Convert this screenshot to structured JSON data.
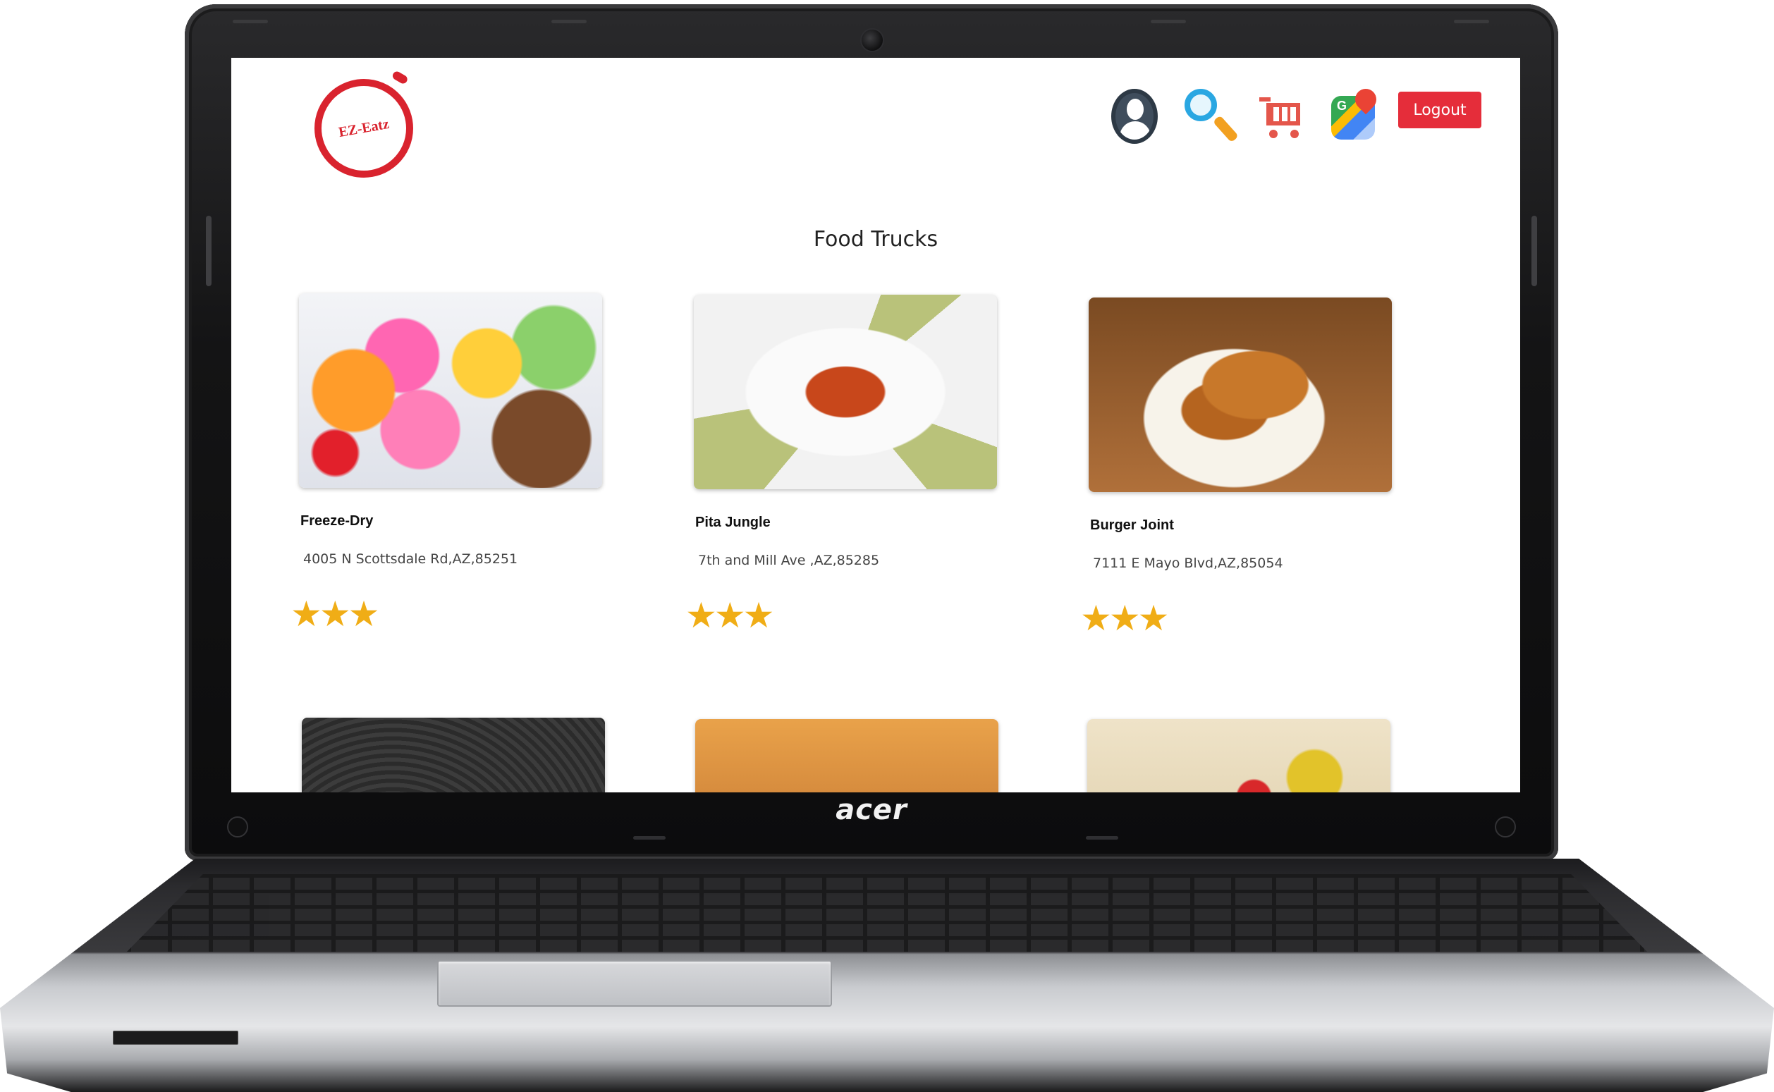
{
  "device": {
    "brand": "acer"
  },
  "app": {
    "logo_text": "EZ-Eatz",
    "logout_label": "Logout",
    "nav_icons": [
      "user-icon",
      "search-icon",
      "cart-icon",
      "maps-icon"
    ]
  },
  "page": {
    "title": "Food Trucks"
  },
  "trucks": [
    {
      "name": "Freeze-Dry",
      "address": "4005 N Scottsdale Rd,AZ,85251",
      "rating": 3,
      "stars": "★★★",
      "image": "ice-cream-photo"
    },
    {
      "name": "Pita Jungle",
      "address": "7th and Mill Ave ,AZ,85285",
      "rating": 3,
      "stars": "★★★",
      "image": "pita-photo"
    },
    {
      "name": "Burger Joint",
      "address": "7111 E Mayo Blvd,AZ,85054",
      "rating": 3,
      "stars": "★★★",
      "image": "fried-chicken-photo"
    },
    {
      "image": "dark-food-photo"
    },
    {
      "image": "chicken-wings-photo"
    },
    {
      "image": "salad-photo"
    }
  ],
  "colors": {
    "accent": "#e52d3a",
    "logo": "#d9232e",
    "star": "#f0ad16"
  }
}
